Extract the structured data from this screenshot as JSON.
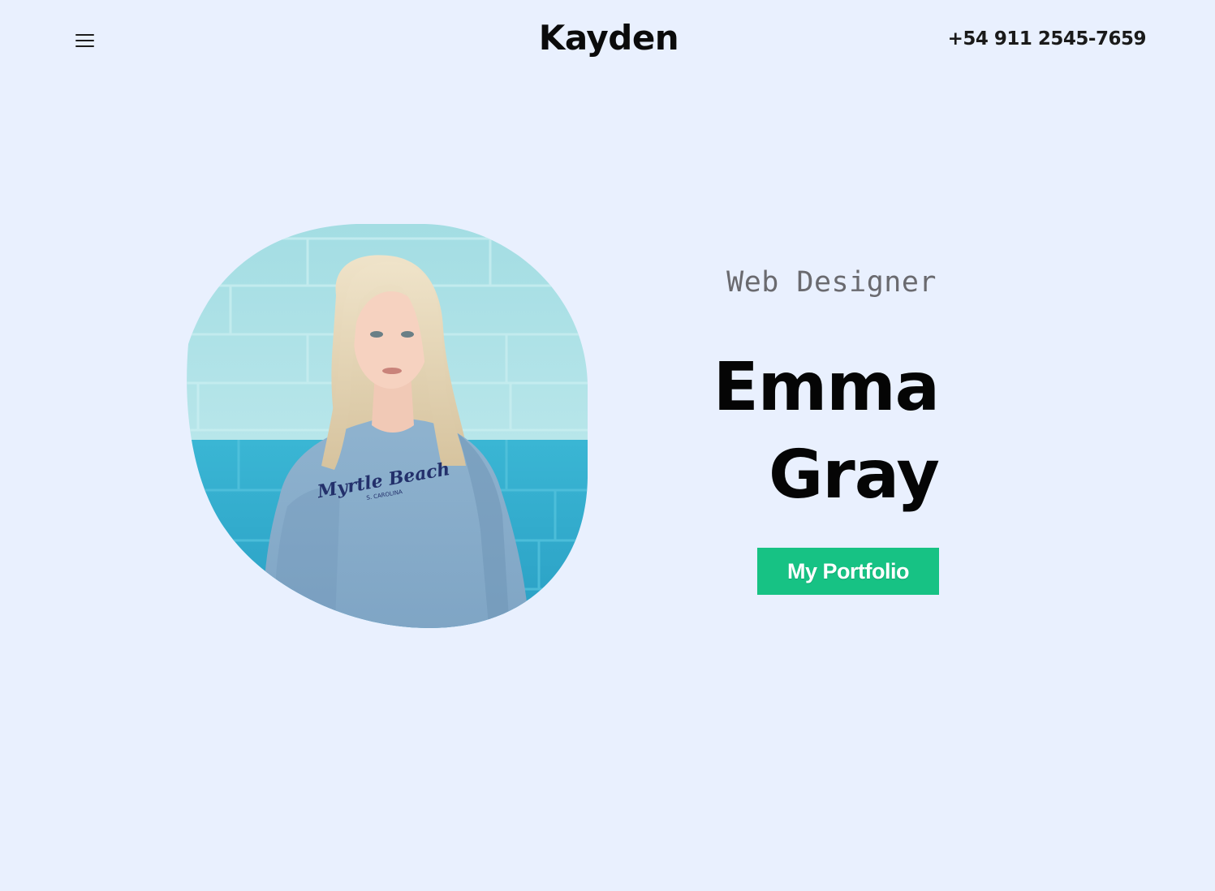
{
  "header": {
    "brand": "Kayden",
    "phone": "+54 911 2545-7659",
    "menu_icon": "hamburger-menu-icon"
  },
  "hero": {
    "role": "Web Designer",
    "first_name": "Emma",
    "last_name": "Gray",
    "cta_label": "My Portfolio",
    "photo": {
      "subject": "portrait-photo",
      "sweatshirt_text": "Myrtle Beach",
      "sweatshirt_subtext": "S. CAROLINA"
    }
  },
  "colors": {
    "background": "#e9f0fe",
    "accent": "#17c284",
    "text": "#050505",
    "muted": "#6a6a6f"
  }
}
